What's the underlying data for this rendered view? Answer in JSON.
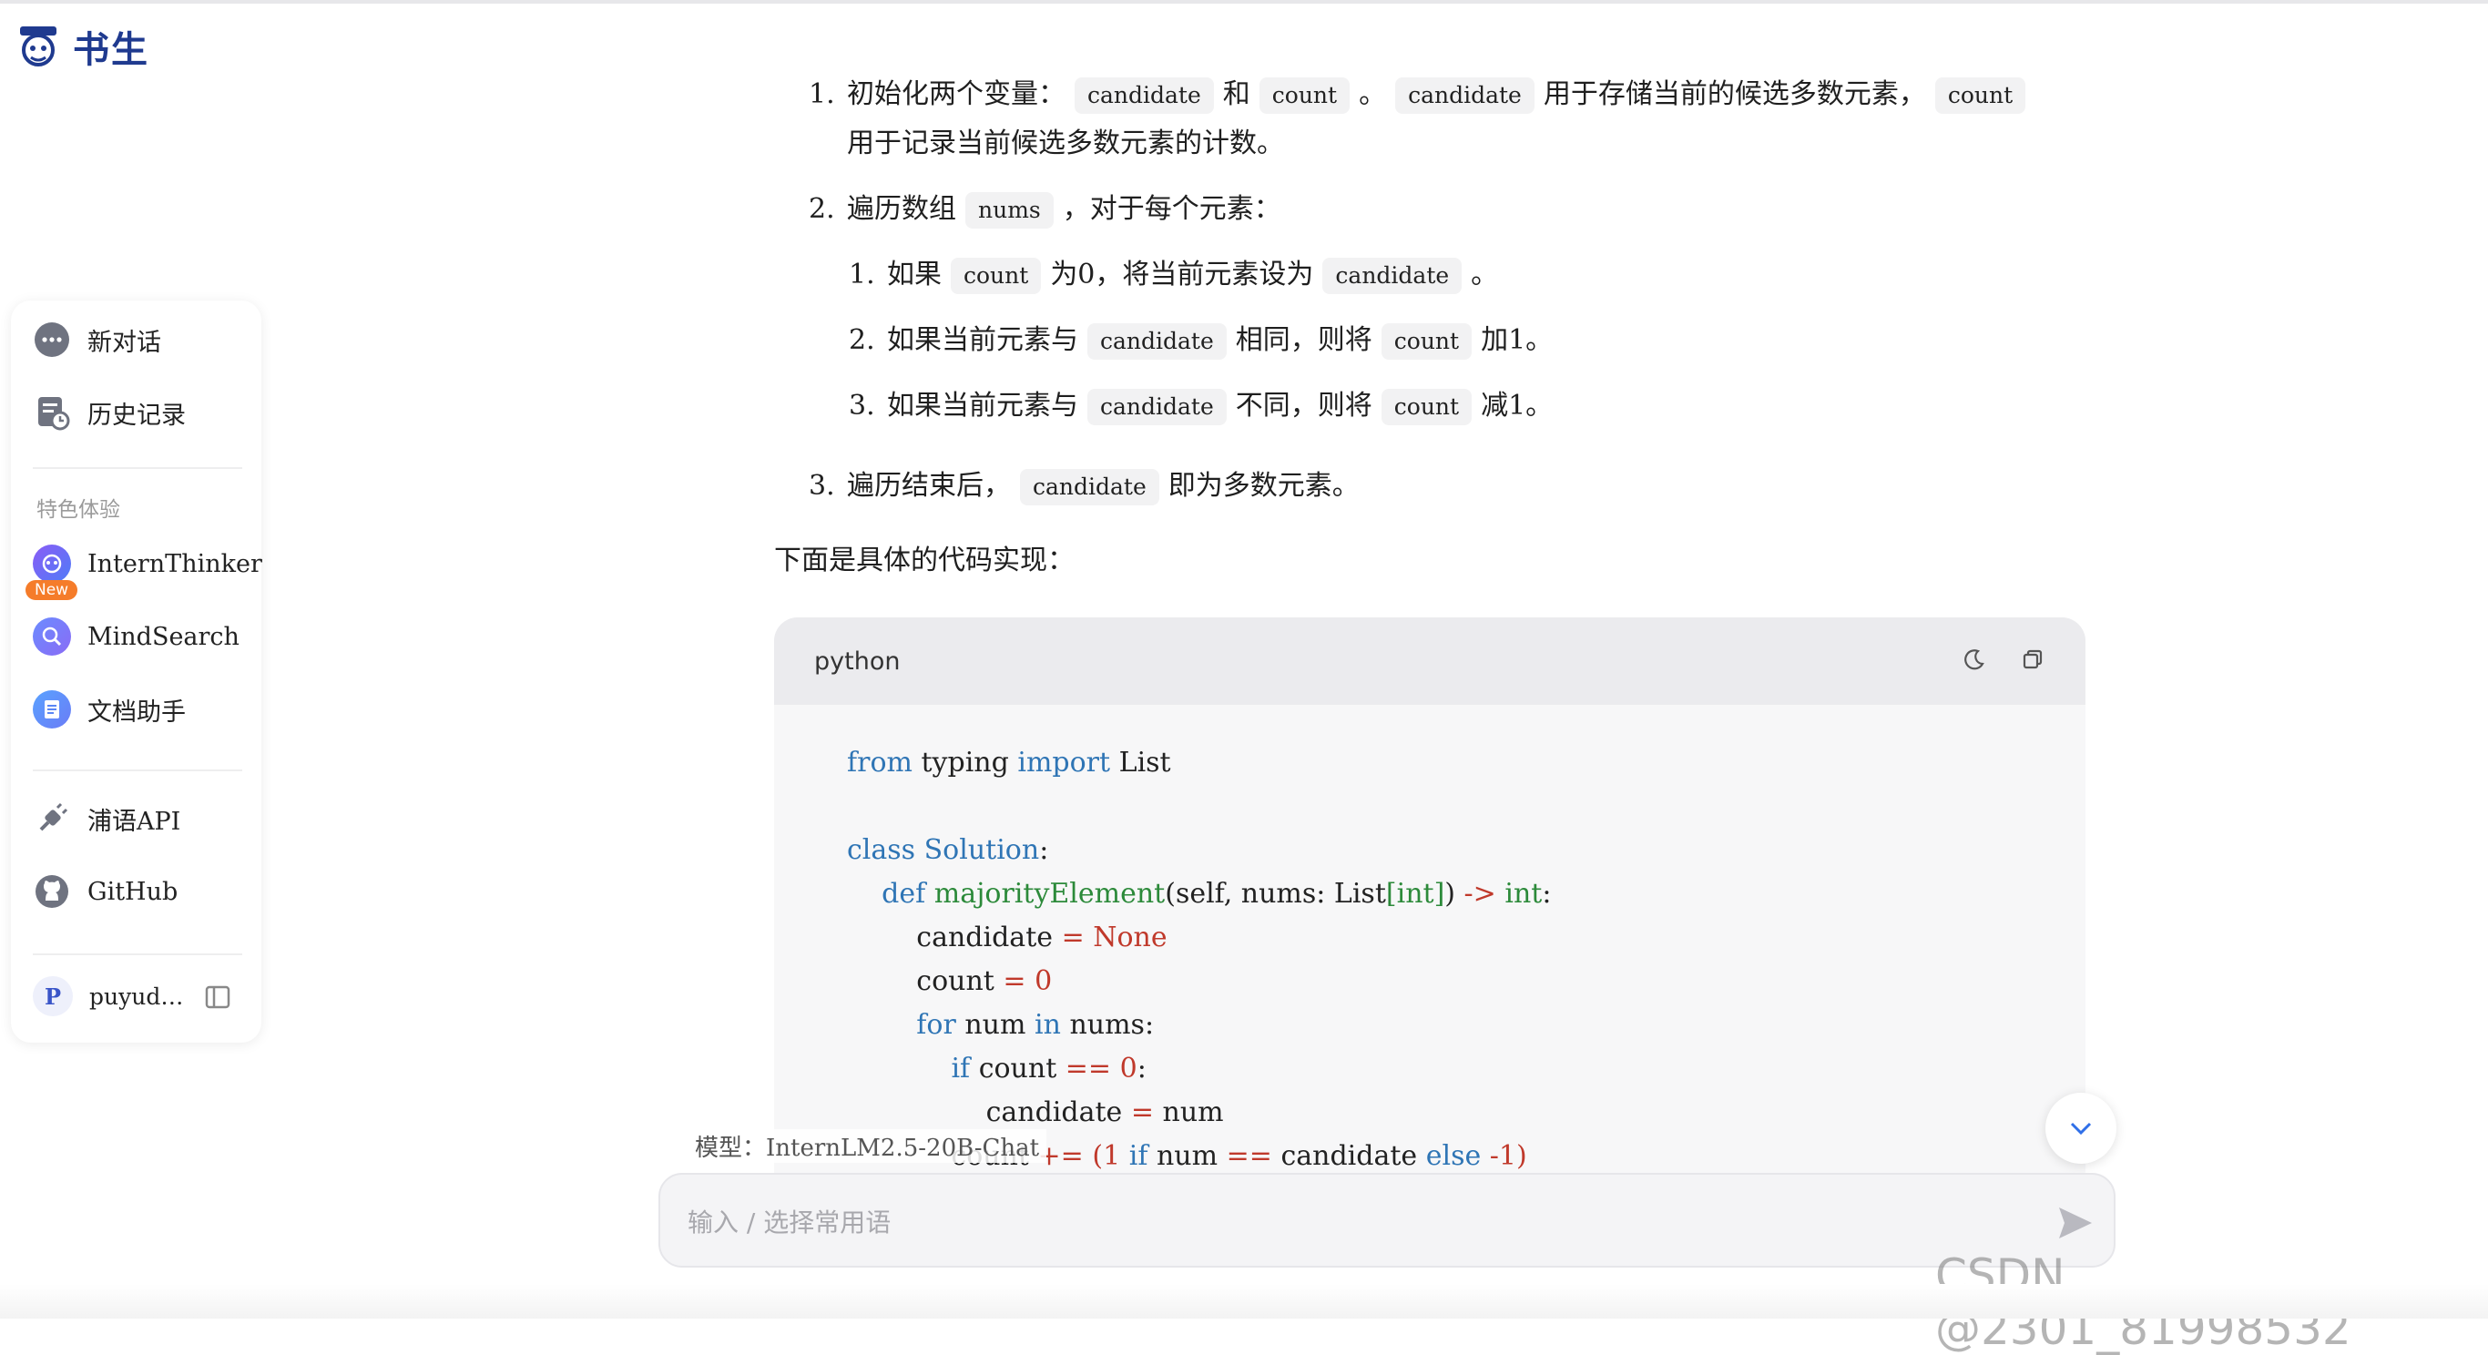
{
  "brand": {
    "name": "书生"
  },
  "sidebar": {
    "new_chat": "新对话",
    "history": "历史记录",
    "section_label": "特色体验",
    "features": [
      {
        "label": "InternThinker",
        "badge": "New"
      },
      {
        "label": "MindSearch"
      },
      {
        "label": "文档助手"
      }
    ],
    "links": [
      {
        "label": "浦语API"
      },
      {
        "label": "GitHub"
      }
    ],
    "user": {
      "initial": "P",
      "name": "puyud…"
    }
  },
  "answer": {
    "steps": [
      {
        "num": "1.",
        "parts": [
          "初始化两个变量：",
          "candidate",
          "和",
          "count",
          "。",
          "candidate",
          "用于存储当前的候选多数元素，",
          "count"
        ],
        "line2": "用于记录当前候选多数元素的计数。"
      },
      {
        "num": "2.",
        "parts": [
          "遍历数组",
          "nums",
          "，对于每个元素："
        ]
      },
      {
        "num": "3.",
        "parts": [
          "遍历结束后，",
          "candidate",
          "即为多数元素。"
        ]
      }
    ],
    "substeps": [
      {
        "num": "1.",
        "parts": [
          "如果",
          "count",
          "为0，将当前元素设为",
          "candidate",
          "。"
        ]
      },
      {
        "num": "2.",
        "parts": [
          "如果当前元素与",
          "candidate",
          "相同，则将",
          "count",
          "加1。"
        ]
      },
      {
        "num": "3.",
        "parts": [
          "如果当前元素与",
          "candidate",
          "不同，则将",
          "count",
          "减1。"
        ]
      }
    ],
    "intro": "下面是具体的代码实现："
  },
  "code_block": {
    "language": "python",
    "lines": [
      "from typing import List",
      "",
      "class Solution:",
      "    def majorityElement(self, nums: List[int]) -> int:",
      "        candidate = None",
      "        count = 0",
      "        for num in nums:",
      "            if count == 0:",
      "                candidate = num",
      "            count += (1 if num == candidate else -1)"
    ]
  },
  "model": {
    "label": "模型：InternLM2.5-20B-Chat"
  },
  "input": {
    "placeholder": "输入 / 选择常用语"
  },
  "watermark": {
    "text": "CSDN @2301_81998532"
  }
}
